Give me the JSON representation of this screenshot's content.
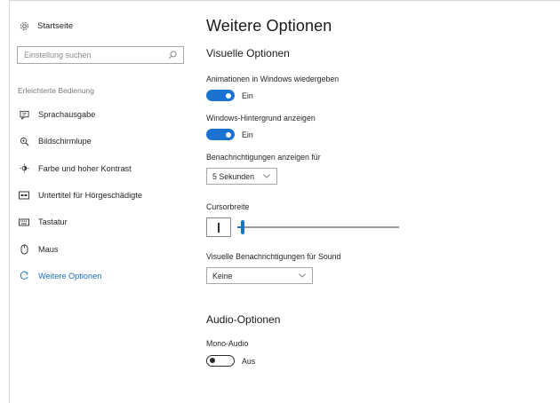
{
  "sidebar": {
    "home_label": "Startseite",
    "search": {
      "placeholder": "Einstellung suchen"
    },
    "section_label": "Erleichterte Bedienung",
    "items": [
      {
        "label": "Sprachausgabe",
        "icon": "narrator-icon"
      },
      {
        "label": "Bildschirmlupe",
        "icon": "magnifier-icon"
      },
      {
        "label": "Farbe und hoher Kontrast",
        "icon": "high-contrast-icon"
      },
      {
        "label": "Untertitel für Hörgeschädigte",
        "icon": "closed-captions-icon"
      },
      {
        "label": "Tastatur",
        "icon": "keyboard-icon"
      },
      {
        "label": "Maus",
        "icon": "mouse-icon"
      },
      {
        "label": "Weitere Optionen",
        "icon": "other-options-icon",
        "active": true
      }
    ]
  },
  "main": {
    "title": "Weitere Optionen",
    "visual": {
      "heading": "Visuelle Optionen",
      "animations": {
        "label": "Animationen in Windows wiedergeben",
        "state": "Ein",
        "on": true
      },
      "background": {
        "label": "Windows-Hintergrund anzeigen",
        "state": "Ein",
        "on": true
      },
      "notifications": {
        "label": "Benachrichtigungen anzeigen für",
        "value": "5 Sekunden"
      },
      "cursor": {
        "label": "Cursorbreite",
        "level": 0.02
      },
      "visual_sound": {
        "label": "Visuelle Benachrichtigungen für Sound",
        "value": "Keine"
      }
    },
    "audio": {
      "heading": "Audio-Optionen",
      "mono": {
        "label": "Mono-Audio",
        "state": "Aus",
        "on": false
      }
    }
  },
  "colors": {
    "accent": "#1a73d0",
    "active_nav": "#1a70c4",
    "text": "#262626"
  }
}
